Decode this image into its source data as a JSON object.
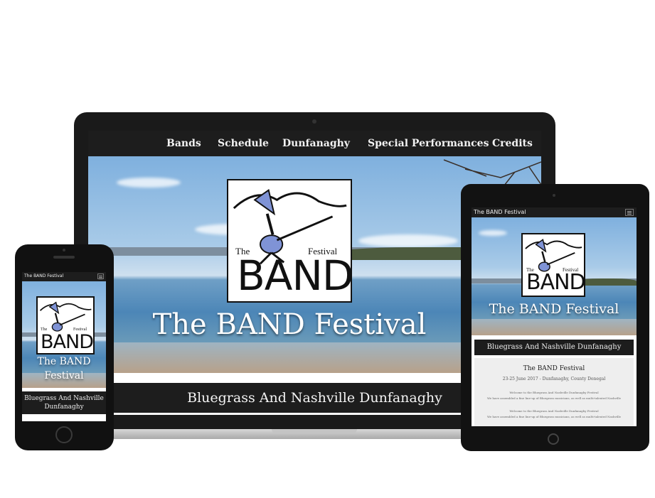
{
  "site": {
    "title": "The BAND Festival",
    "logo": {
      "the": "The",
      "festival": "Festival",
      "band": "BAND"
    },
    "subtitle": "Bluegrass And Nashville Dunfanaghy"
  },
  "laptop": {
    "nav": [
      "Bands",
      "Schedule",
      "Dunfanaghy",
      "Special Performances",
      "Credits"
    ]
  },
  "tablet": {
    "nav_title": "The BAND Festival",
    "content": {
      "heading": "The BAND Festival",
      "dates": "23-25 June 2017 - Dunfanaghy, County Donegal",
      "line1": "Welcome to the Bluegrass And Nashville Dunfanaghy Festival",
      "line2": "We have assembled a fine line-up of Bluegrass musicians, as well as multi-talented Nashville",
      "line3": "Welcome to the Bluegrass And Nashville Dunfanaghy Festival",
      "line4": "We have assembled a fine line-up of Bluegrass musicians, as well as multi-talented Nashville"
    }
  },
  "phone": {
    "nav_title": "The BAND Festival",
    "hero_title_line1": "The BAND",
    "hero_title_line2": "Festival",
    "subtitle_line1": "Bluegrass And Nashville",
    "subtitle_line2": "Dunfanaghy"
  },
  "colors": {
    "nav_bg": "#1d1d1d",
    "logo_accent": "#7f93d6",
    "text_light": "#f2f2f2"
  }
}
